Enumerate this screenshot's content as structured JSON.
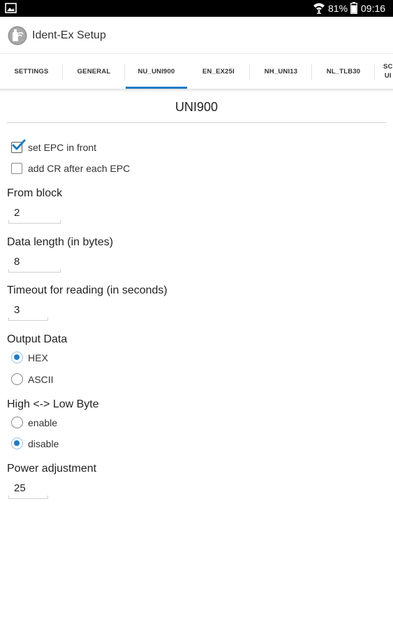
{
  "status_bar": {
    "battery_percent": "81%",
    "time": "09:16",
    "icons": [
      "gallery-icon",
      "wifi-icon",
      "battery-icon"
    ]
  },
  "app_bar": {
    "title": "Ident-Ex Setup"
  },
  "tabs": [
    {
      "label": "SETTINGS",
      "active": false
    },
    {
      "label": "GENERAL",
      "active": false
    },
    {
      "label": "NU_UNI900",
      "active": true
    },
    {
      "label": "EN_EX25I",
      "active": false
    },
    {
      "label": "NH_UNI13",
      "active": false
    },
    {
      "label": "NL_TLB30",
      "active": false
    },
    {
      "label_line1": "SC",
      "label_line2": "UI",
      "active": false
    }
  ],
  "colors": {
    "accent": "#1e7bc4"
  },
  "section_title": "UNI900",
  "checkboxes": [
    {
      "label": "set EPC in front",
      "checked": true
    },
    {
      "label": "add CR after each EPC",
      "checked": false
    }
  ],
  "fields": {
    "from_block": {
      "label": "From block",
      "value": "2"
    },
    "data_length": {
      "label": "Data length (in bytes)",
      "value": "8"
    },
    "timeout": {
      "label": "Timeout for reading (in seconds)",
      "value": "3"
    },
    "power": {
      "label": "Power adjustment",
      "value": "25"
    }
  },
  "output_data": {
    "label": "Output Data",
    "options": [
      {
        "label": "HEX",
        "selected": true
      },
      {
        "label": "ASCII",
        "selected": false
      }
    ]
  },
  "byte_order": {
    "label": "High <-> Low Byte",
    "options": [
      {
        "label": "enable",
        "selected": false
      },
      {
        "label": "disable",
        "selected": true
      }
    ]
  }
}
